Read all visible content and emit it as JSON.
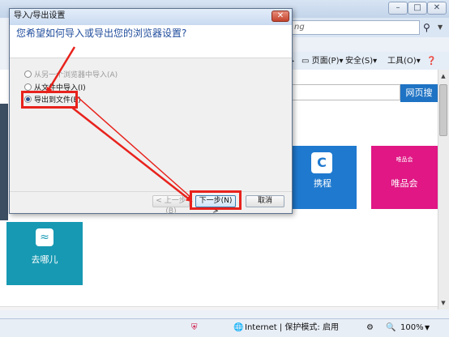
{
  "browser": {
    "title": "",
    "window_buttons": [
      "–",
      "□",
      "✕"
    ],
    "address_text": "ng",
    "menu": [
      {
        "label": "页面(P)",
        "caret": "▾"
      },
      {
        "label": "安全(S)",
        "caret": "▾"
      },
      {
        "label": "工具(O)",
        "caret": "▾"
      }
    ],
    "search_button": "网页搜",
    "tiles": [
      {
        "label": "携程",
        "glyph": "C"
      },
      {
        "label": "唯品会",
        "glyph": "唯品会"
      },
      {
        "label": "去哪儿",
        "glyph": "≈"
      }
    ],
    "status": {
      "zone": "Internet | 保护模式: 启用",
      "zoom": "100%"
    }
  },
  "dialog": {
    "title": "导入/导出设置",
    "close_label": "✕",
    "question": "您希望如何导入或导出您的浏览器设置?",
    "options": [
      {
        "label": "从另一个浏览器中导入(A)",
        "enabled": false,
        "selected": false
      },
      {
        "label": "从文件中导入(I)",
        "enabled": true,
        "selected": false
      },
      {
        "label": "导出到文件(E)",
        "enabled": true,
        "selected": true
      }
    ],
    "buttons": {
      "back": "< 上一步(B)",
      "next": "下一步(N) >",
      "cancel": "取消"
    }
  },
  "colors": {
    "annotation": "#e8221c",
    "dialog_question": "#1f4c9c",
    "tile_travel": "#1f79cf",
    "tile_shop": "#e01785",
    "tile_qunar": "#1799b3",
    "search_button": "#1f73c4"
  }
}
